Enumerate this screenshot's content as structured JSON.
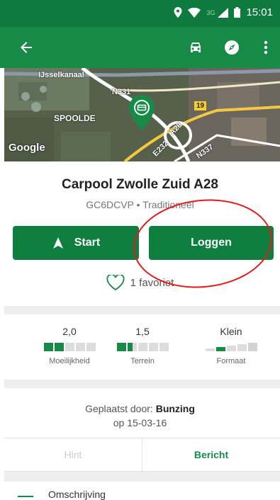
{
  "status_bar": {
    "network": "3G",
    "time": "15:01"
  },
  "app_bar": {
    "icons": [
      "back-arrow-icon",
      "car-icon",
      "compass-icon",
      "more-vert-icon"
    ]
  },
  "map": {
    "labels": {
      "canal": "IJsselkanaal",
      "n331": "N331",
      "town": "SPOOLDE",
      "route19": "19",
      "a28": "A28",
      "e232": "E232",
      "n337": "N337",
      "google": "Google"
    }
  },
  "cache": {
    "title": "Carpool Zwolle Zuid A28",
    "subtitle": "GC6DCVP • Traditioneel"
  },
  "actions": {
    "start_label": "Start",
    "log_label": "Loggen"
  },
  "favorites": {
    "label": "1 favoriet"
  },
  "stats": {
    "difficulty": {
      "value": "2,0",
      "label": "Moeilijkheid",
      "rating": 2
    },
    "terrain": {
      "value": "1,5",
      "label": "Terrein",
      "rating": 1.5
    },
    "size": {
      "value": "Klein",
      "label": "Formaat"
    }
  },
  "placed": {
    "prefix": "Geplaatst door:",
    "owner": "Bunzing",
    "date_line": "op 15-03-16"
  },
  "tabs": {
    "hint": "Hint",
    "message": "Bericht"
  },
  "section": {
    "description": "Omschrijving"
  },
  "colors": {
    "primary": "#178a48",
    "status_bar": "#0f7a3e",
    "annotation": "#e21a1a"
  }
}
